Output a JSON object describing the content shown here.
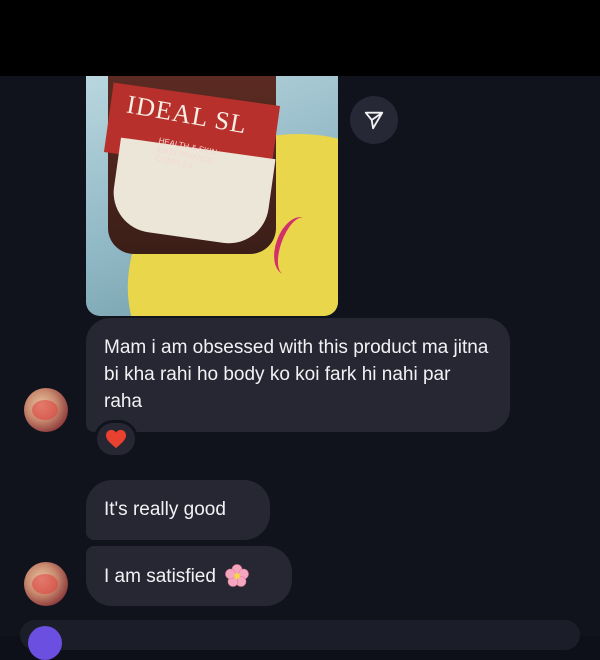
{
  "photo": {
    "brand_text": "IDEAL SL",
    "sub_text": "HEALTH & SKIN MAINTENANCE COMPLEX"
  },
  "messages": [
    {
      "text": "Mam i am obsessed with this product ma jitna bi kha rahi ho body ko koi fark hi nahi par raha",
      "reaction": "red-heart"
    },
    {
      "text": "It's really good"
    },
    {
      "text": "I am satisfied",
      "emoji": "pink-flower"
    }
  ],
  "colors": {
    "background": "#10121c",
    "bubble": "#262733",
    "text": "#f2f2f4",
    "heart": "#e8412f",
    "flower": "#f3a6bd"
  }
}
